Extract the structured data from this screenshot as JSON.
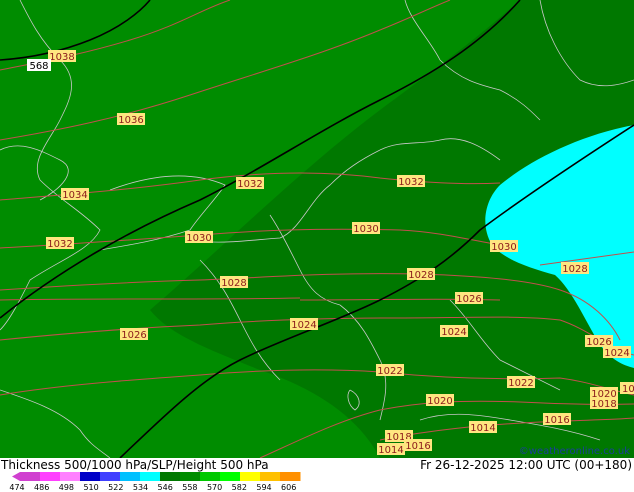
{
  "map": {
    "contour_labels": [
      {
        "text": "1038"
      },
      {
        "text": "1036"
      },
      {
        "text": "1034"
      },
      {
        "text": "1032"
      },
      {
        "text": "1032"
      },
      {
        "text": "1032"
      },
      {
        "text": "1030"
      },
      {
        "text": "1030"
      },
      {
        "text": "1030"
      },
      {
        "text": "1028"
      },
      {
        "text": "1028"
      },
      {
        "text": "1028"
      },
      {
        "text": "1026"
      },
      {
        "text": "1026"
      },
      {
        "text": "1026"
      },
      {
        "text": "1024"
      },
      {
        "text": "1024"
      },
      {
        "text": "1024"
      },
      {
        "text": "1022"
      },
      {
        "text": "1022"
      },
      {
        "text": "1020"
      },
      {
        "text": "1020"
      },
      {
        "text": "1018"
      },
      {
        "text": "1018"
      },
      {
        "text": "1016"
      },
      {
        "text": "1016"
      },
      {
        "text": "1014"
      },
      {
        "text": "1014"
      },
      {
        "text": "102"
      }
    ],
    "height_label": "568",
    "colors": {
      "zone_534_546": "#008c00",
      "zone_528_534": "#007800",
      "zone_510_522": "#00ffff",
      "isobar": "#c0504d",
      "height_line": "#000000",
      "border": "#c8c8c8"
    }
  },
  "footer": {
    "title": "Thickness 500/1000 hPa/SLP/Height 500 hPa",
    "datetime": "Fr 26-12-2025 12:00 UTC (00+180)",
    "credit": "©weatheronline.co.uk",
    "scale_ticks": [
      "474",
      "486",
      "498",
      "510",
      "522",
      "534",
      "546",
      "558",
      "570",
      "582",
      "594",
      "606"
    ],
    "scale_colors": [
      "#d040d0",
      "#ff40ff",
      "#ff80ff",
      "#0000c8",
      "#4040ff",
      "#00c0ff",
      "#00ffff",
      "#007800",
      "#008c00",
      "#00c800",
      "#00ff00",
      "#ffff00",
      "#ffc000",
      "#ff9000"
    ]
  }
}
